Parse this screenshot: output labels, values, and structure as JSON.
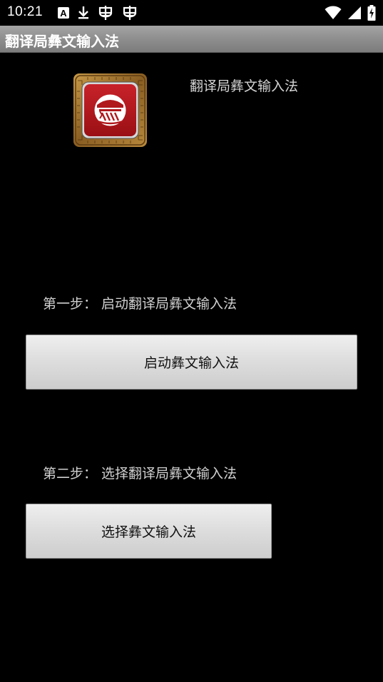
{
  "status_bar": {
    "time": "10:21",
    "icons_left": [
      "text-a-icon",
      "download-icon",
      "bug-icon",
      "bug-icon"
    ],
    "icons_right": [
      "wifi-icon",
      "signal-icon",
      "battery-charging-icon"
    ]
  },
  "action_bar": {
    "title": "翻译局彝文输入法"
  },
  "header": {
    "app_name": "翻译局彝文输入法",
    "icon": "app-logo-icon"
  },
  "steps": {
    "step1_label": "第一步： 启动翻译局彝文输入法",
    "step1_button": "启动彝文输入法",
    "step2_label": "第二步： 选择翻译局彝文输入法",
    "step2_button": "选择彝文输入法"
  },
  "colors": {
    "background": "#000000",
    "action_bar": "#8e8e8e",
    "button": "#dedede",
    "logo_red": "#b0181c",
    "logo_gold": "#a87a30"
  }
}
